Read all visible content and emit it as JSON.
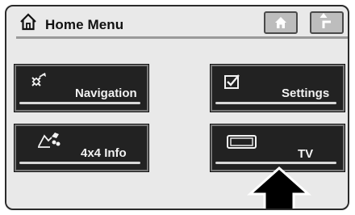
{
  "header": {
    "title": "Home Menu",
    "home_icon": "house-outline-icon",
    "buttons": [
      {
        "name": "home-button",
        "icon": "house-icon"
      },
      {
        "name": "back-button",
        "icon": "return-arrow-icon"
      }
    ]
  },
  "menu": {
    "items": [
      {
        "label": "Navigation",
        "icon": "satellite-navigation-icon"
      },
      {
        "label": "Settings",
        "icon": "checkbox-icon"
      },
      {
        "label": "4x4 Info",
        "icon": "terrain-vehicle-icon"
      },
      {
        "label": "TV",
        "icon": "tv-screen-icon"
      }
    ]
  },
  "pointer": {
    "icon": "up-arrow-pointer",
    "target": "TV"
  },
  "colors": {
    "screen_bg": "#e9e9e9",
    "tile_bg": "#222222",
    "tile_text": "#f2f2f2",
    "button_bg": "#bdbdbd"
  }
}
